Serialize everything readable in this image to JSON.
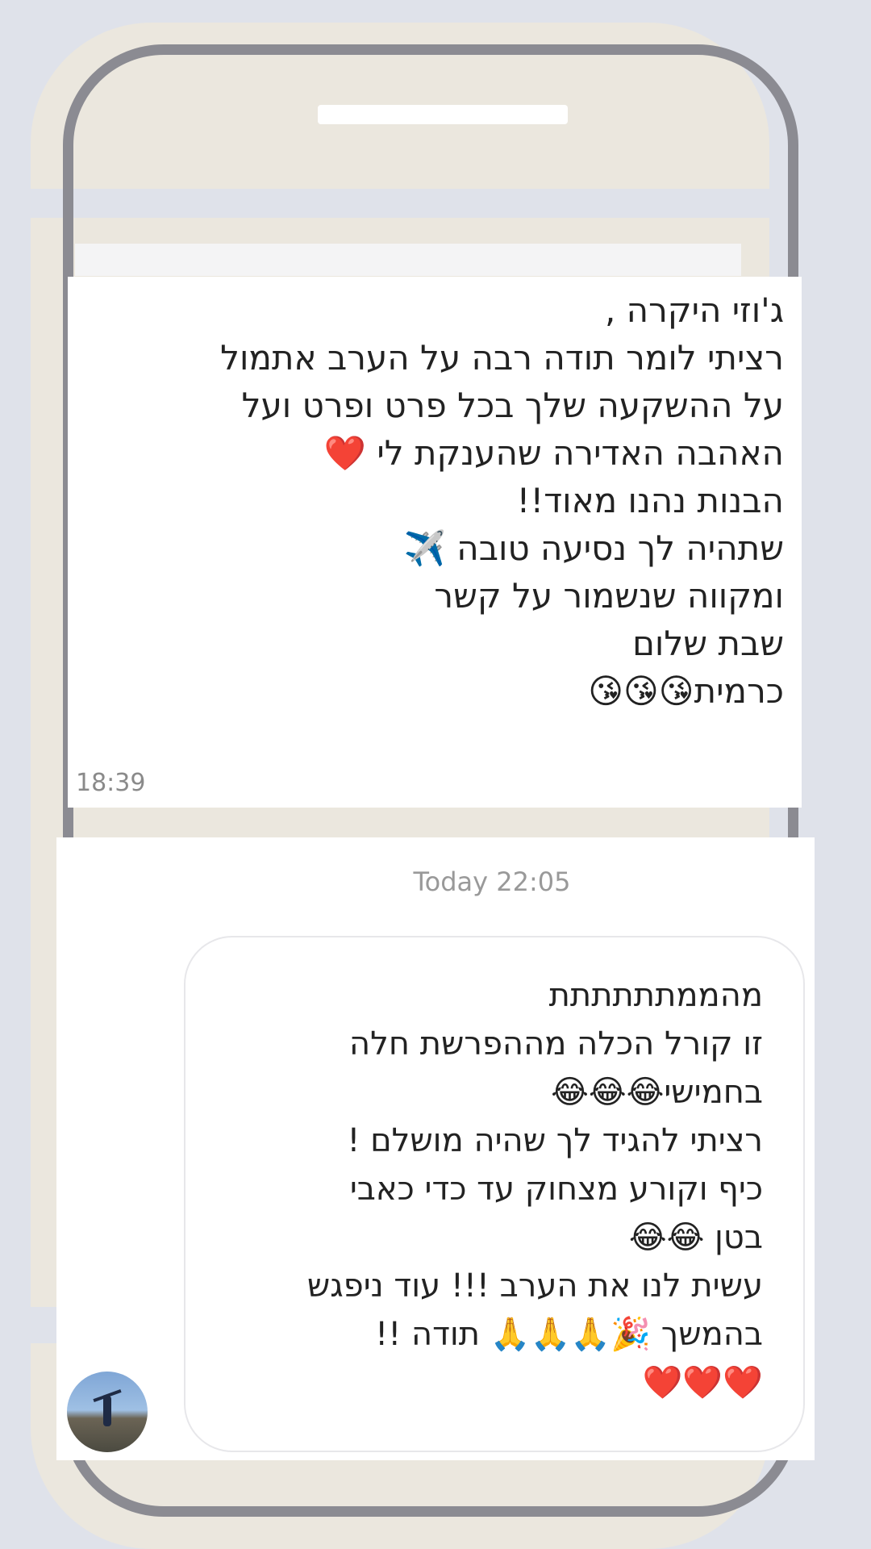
{
  "chat": {
    "message1": {
      "lines": "ג'וזי היקרה ,\nרציתי לומר תודה רבה על הערב אתמול\nעל ההשקעה שלך בכל פרט ופרט ועל\nהאהבה האדירה שהענקת לי ❤️\nהבנות נהנו מאוד!!\nשתהיה לך נסיעה טובה ✈️\nומקווה שנשמור על קשר\nשבת שלום\nכרמית😘😘😘",
      "time": "18:39"
    },
    "date_separator": "Today 22:05",
    "message2": {
      "lines": "מהממתתתתתת\nזו קורל הכלה מההפרשת חלה\nבחמישי😂😂😂\nרציתי להגיד לך שהיה מושלם !\nכיף וקורע מצחוק עד כדי כאבי\nבטן 😂😂\nעשית לנו את הערב !!! עוד ניפגש\nבהמשך 🎉🙏🙏🙏 תודה !!\n❤️❤️❤️"
    }
  },
  "icons": {
    "avatar": "sender-avatar"
  }
}
